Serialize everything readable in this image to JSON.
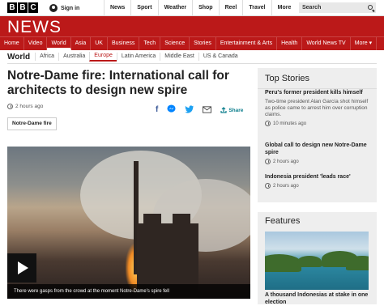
{
  "header": {
    "logo_letters": [
      "B",
      "B",
      "C"
    ],
    "signin_label": "Sign in",
    "nav": [
      "News",
      "Sport",
      "Weather",
      "Shop",
      "Reel",
      "Travel",
      "More"
    ],
    "search_placeholder": "Search"
  },
  "masthead": {
    "title": "NEWS",
    "nav": [
      "Home",
      "Video",
      "World",
      "Asia",
      "UK",
      "Business",
      "Tech",
      "Science",
      "Stories",
      "Entertainment & Arts",
      "Health",
      "World News TV",
      "More"
    ],
    "active": "World",
    "more_suffix": "▾"
  },
  "subnav": {
    "section": "World",
    "items": [
      "Africa",
      "Australia",
      "Europe",
      "Latin America",
      "Middle East",
      "US & Canada"
    ],
    "active": "Europe"
  },
  "article": {
    "headline": "Notre-Dame fire: International call for architects to design new spire",
    "timestamp": "2 hours ago",
    "share_label": "Share",
    "tag": "Notre-Dame fire",
    "caption": "There were gasps from the crowd at the moment Notre-Dame's spire fell"
  },
  "top_stories": {
    "title": "Top Stories",
    "items": [
      {
        "headline": "Peru's former president kills himself",
        "summary": "Two-time president Alan García shot himself as police came to arrest him over corruption claims.",
        "time": "10 minutes ago"
      },
      {
        "headline": "Global call to design new Notre-Dame spire",
        "time": "2 hours ago"
      },
      {
        "headline": "Indonesia president 'leads race'",
        "time": "2 hours ago"
      }
    ]
  },
  "features": {
    "title": "Features",
    "headline": "A thousand Indonesias at stake in one election"
  },
  "colors": {
    "brand_red": "#bb1919",
    "share_teal": "#0a7d8c",
    "facebook": "#3b5998",
    "messenger": "#0084ff",
    "twitter": "#1da1f2"
  },
  "icons": [
    "user-icon",
    "search-icon",
    "clock-icon",
    "facebook-icon",
    "messenger-icon",
    "twitter-icon",
    "email-icon",
    "share-icon",
    "play-icon"
  ]
}
